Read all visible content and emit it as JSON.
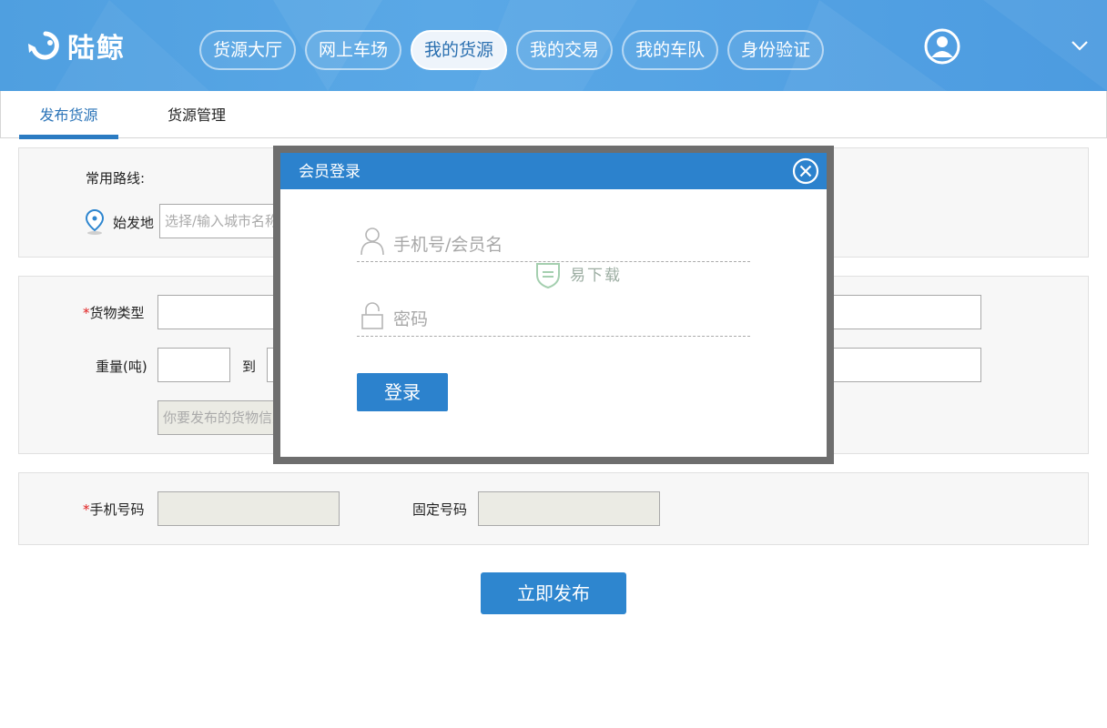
{
  "brand": {
    "name": "陆鲸",
    "logo_icon": "whale-logo-icon"
  },
  "nav": {
    "items": [
      {
        "label": "货源大厅",
        "active": false
      },
      {
        "label": "网上车场",
        "active": false
      },
      {
        "label": "我的货源",
        "active": true
      },
      {
        "label": "我的交易",
        "active": false
      },
      {
        "label": "我的车队",
        "active": false
      },
      {
        "label": "身份验证",
        "active": false
      }
    ],
    "avatar_icon": "user-avatar-icon",
    "menu_icon": "chevron-down-icon"
  },
  "tabs": [
    {
      "label": "发布货源",
      "active": true
    },
    {
      "label": "货源管理",
      "active": false
    }
  ],
  "route_panel": {
    "common_routes_label": "常用路线:",
    "origin_label": "始发地",
    "origin_placeholder": "选择/输入城市名称"
  },
  "goods_panel": {
    "required_mark": "*",
    "goods_type_label": "货物类型",
    "weight_label": "重量(吨)",
    "to_label": "到",
    "description_placeholder": "你要发布的货物信息"
  },
  "contact_panel": {
    "required_mark": "*",
    "mobile_label": "手机号码",
    "landline_label": "固定号码"
  },
  "publish_button": "立即发布",
  "login_modal": {
    "title": "会员登录",
    "username_placeholder": "手机号/会员名",
    "password_placeholder": "密码",
    "login_button": "登录"
  },
  "watermark": {
    "text": "易下载"
  },
  "colors": {
    "primary": "#2c82cd",
    "header": "#4f9fe0",
    "required": "#e02020"
  }
}
